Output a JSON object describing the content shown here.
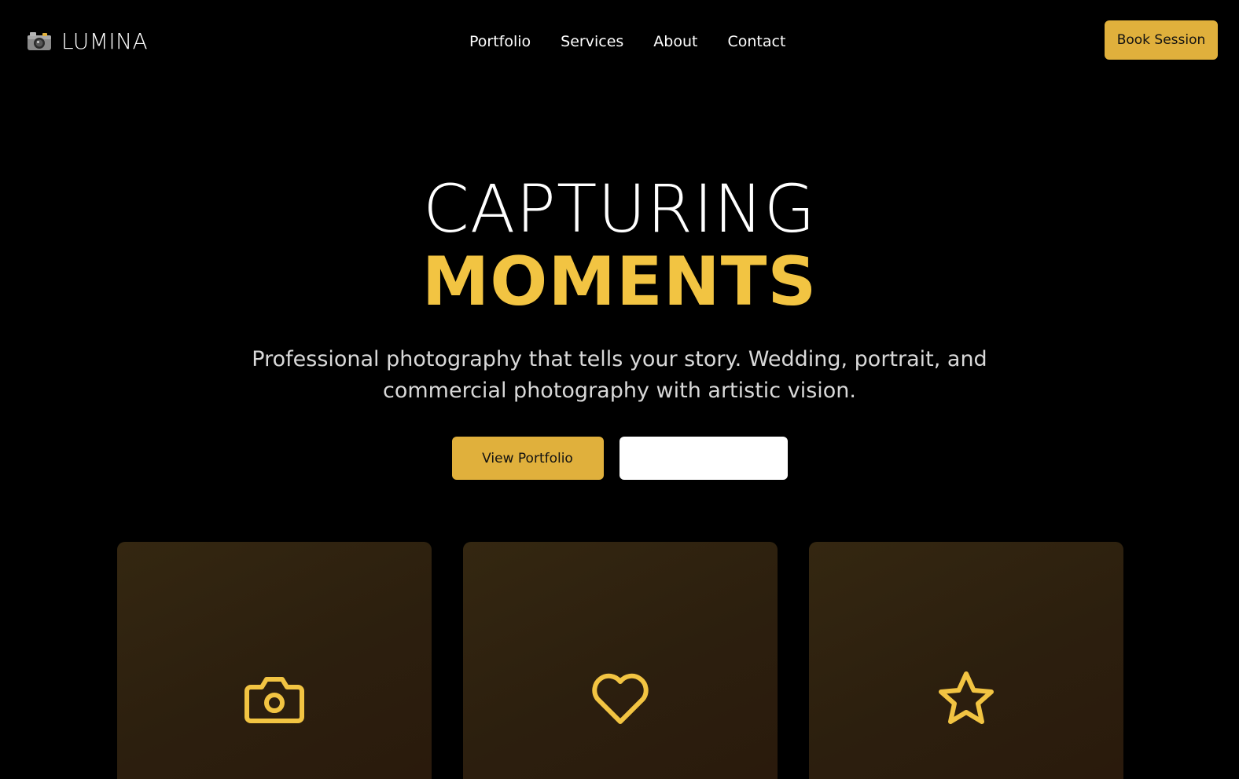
{
  "brand": {
    "name": "LUMINA",
    "logo_icon": "camera-with-flash-icon"
  },
  "nav": {
    "items": [
      {
        "label": "Portfolio"
      },
      {
        "label": "Services"
      },
      {
        "label": "About"
      },
      {
        "label": "Contact"
      }
    ]
  },
  "header": {
    "book_label": "Book Session"
  },
  "hero": {
    "title_line1": "CAPTURING",
    "title_line2": "MOMENTS",
    "subtitle": "Professional photography that tells your story. Wedding, portrait, and commercial photography with artistic vision.",
    "primary_cta": "View Portfolio",
    "secondary_cta": ""
  },
  "cards": [
    {
      "icon": "camera-icon"
    },
    {
      "icon": "heart-icon"
    },
    {
      "icon": "star-icon"
    }
  ],
  "colors": {
    "background": "#000000",
    "accent": "#E0B03C",
    "accent_text": "#F2C442",
    "card_bg": "#2E2110"
  }
}
